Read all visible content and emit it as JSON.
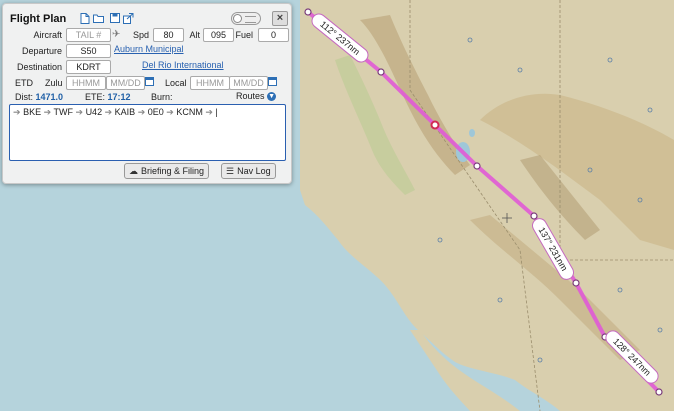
{
  "map": {
    "leg_labels": [
      "112° 237nm",
      "137° 231nm",
      "128° 247nm"
    ]
  },
  "panel": {
    "title": "Flight Plan",
    "toolbar_icons": [
      "new-document-icon",
      "open-folder-icon",
      "save-icon",
      "share-icon"
    ],
    "aircraft": {
      "label": "Aircraft",
      "placeholder": "TAIL #"
    },
    "spd": {
      "label": "Spd",
      "value": "80"
    },
    "alt": {
      "label": "Alt",
      "value": "095"
    },
    "fuel": {
      "label": "Fuel",
      "value": "0"
    },
    "departure": {
      "label": "Departure",
      "value": "S50",
      "name": "Auburn Municipal"
    },
    "destination": {
      "label": "Destination",
      "value": "KDRT",
      "name": "Del Rio International"
    },
    "etd": {
      "label": "ETD",
      "zulu_label": "Zulu",
      "zulu_time_placeholder": "HHMM",
      "zulu_date_placeholder": "MM/DD",
      "local_label": "Local",
      "local_time_placeholder": "HHMM",
      "local_date_placeholder": "MM/DD"
    },
    "summary": {
      "dist_label": "Dist:",
      "dist_value": "1471.0",
      "ete_label": "ETE:",
      "ete_value": "17:12",
      "burn_label": "Burn:",
      "routes_label": "Routes"
    },
    "route": [
      "BKE",
      "TWF",
      "U42",
      "KAIB",
      "0E0",
      "KCNM"
    ],
    "buttons": {
      "briefing": "Briefing & Filing",
      "navlog": "Nav Log"
    }
  },
  "colors": {
    "route_line": "#e05ad6",
    "link": "#2861b0",
    "accent": "#1f5fa6"
  }
}
